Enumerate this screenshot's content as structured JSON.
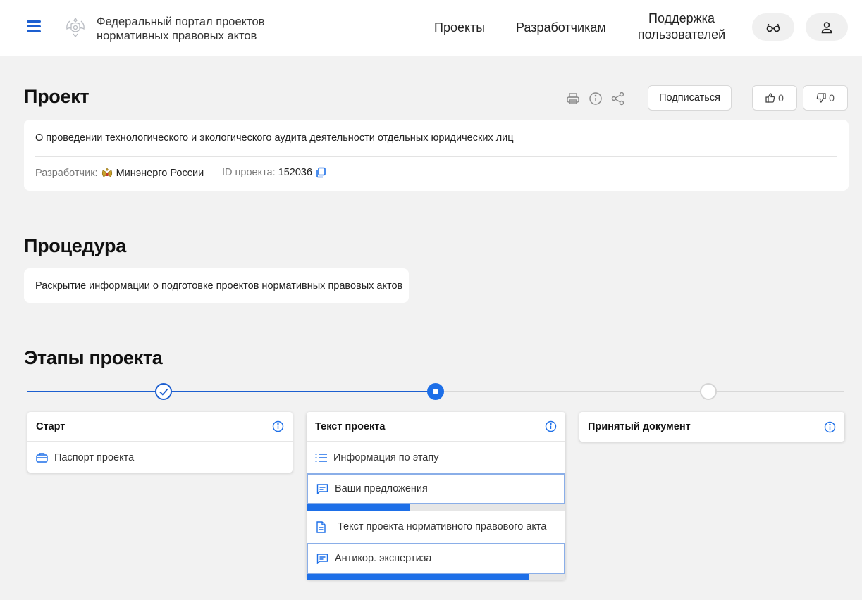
{
  "header": {
    "portal_title_line1": "Федеральный портал проектов",
    "portal_title_line2": "нормативных правовых актов",
    "nav": {
      "projects": "Проекты",
      "developers": "Разработчикам",
      "support_line1": "Поддержка",
      "support_line2": "пользователей"
    },
    "icons": [
      "menu-icon",
      "emblem-icon",
      "glasses-icon",
      "user-icon"
    ]
  },
  "project": {
    "heading": "Проект",
    "subscribe_label": "Подписаться",
    "likes": "0",
    "dislikes": "0",
    "description": "О проведении технологического и экологического аудита деятельности отдельных юридических лиц",
    "developer_label": "Разработчик:",
    "developer_name": "Минэнерго России",
    "id_label": "ID проекта:",
    "id_value": "152036"
  },
  "procedure": {
    "heading": "Процедура",
    "text": "Раскрытие информации о подготовке проектов нормативных правовых актов"
  },
  "stages": {
    "heading": "Этапы проекта",
    "list": [
      {
        "title": "Старт",
        "status": "done",
        "items": [
          {
            "label": "Паспорт проекта",
            "icon": "briefcase-icon"
          }
        ]
      },
      {
        "title": "Текст проекта",
        "status": "current",
        "items": [
          {
            "label": "Информация по этапу",
            "icon": "list-icon"
          },
          {
            "label": "Ваши предложения",
            "icon": "comment-icon",
            "progress": 0.4
          },
          {
            "label": "Текст проекта нормативного правового акта",
            "icon": "document-icon"
          },
          {
            "label": "Антикор. экспертиза",
            "icon": "comment-icon",
            "progress": 0.86
          }
        ]
      },
      {
        "title": "Принятый документ",
        "status": "future",
        "items": []
      }
    ]
  },
  "colors": {
    "accent": "#1d5fd0",
    "accent_bright": "#1d6fe8",
    "background": "#f2f2f2"
  }
}
